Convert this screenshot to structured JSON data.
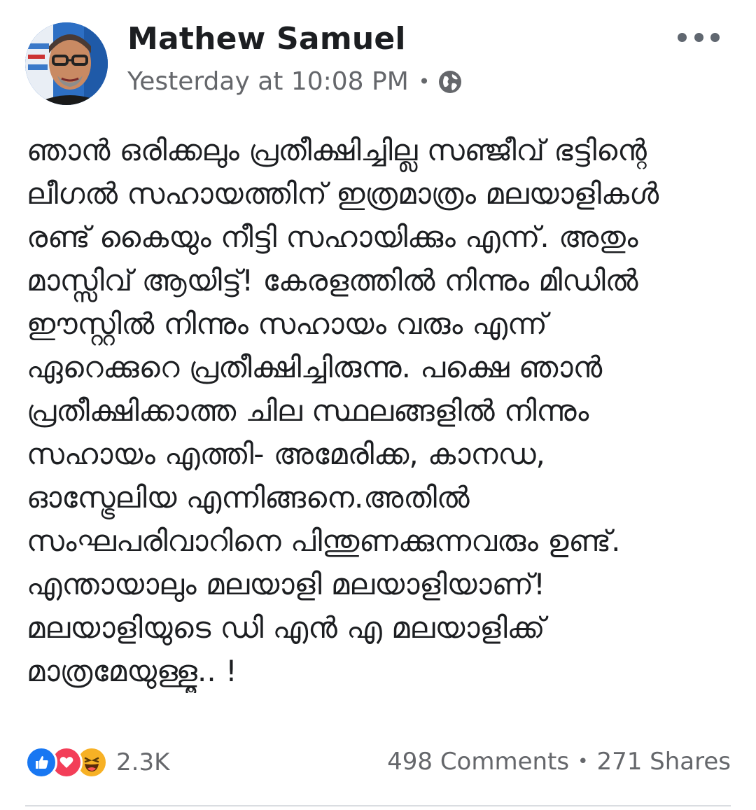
{
  "post": {
    "author": "Mathew Samuel",
    "timestamp": "Yesterday at 10:08 PM",
    "separator": "•",
    "privacy_icon": "globe-icon",
    "more_icon": "more-options-icon",
    "text_lines": [
      "ഞാൻ ഒരിക്കലും പ്രതീക്ഷിച്ചില്ല സഞ്ജീവ് ഭട്ടിന്റെ",
      "ലീഗൽ സഹായത്തിന് ഇത്രമാത്രം മലയാളികൾ",
      "രണ്ട് കൈയും നീട്ടി സഹായിക്കും എന്ന്. അതും",
      "മാസ്സിവ് ആയിട്ട്! കേരളത്തിൽ നിന്നും മിഡിൽ",
      "ഈസ്റ്റിൽ  നിന്നും സഹായം വരും എന്ന്",
      "ഏറെക്കുറെ പ്രതീക്ഷിച്ചിരുന്നു. പക്ഷെ ഞാൻ",
      "പ്രതീക്ഷിക്കാത്ത ചില സ്ഥലങ്ങളിൽ നിന്നും",
      "സഹായം എത്തി- അമേരിക്ക, കാനഡ,",
      "ഓസ്ട്രേലിയ എന്നിങ്ങനെ.അതിൽ",
      "സംഘപരിവാറിനെ പിന്തുണക്കുന്നവരും ഉണ്ട്.",
      "എന്തായാലും മലയാളി മലയാളിയാണ്!",
      "മലയാളിയുടെ ഡി എൻ എ മലയാളിക്ക്",
      "മാത്രമേയുള്ളൂ.. !"
    ]
  },
  "footer": {
    "reaction_icons": [
      "like-icon",
      "love-icon",
      "haha-icon"
    ],
    "reaction_count": "2.3K",
    "comments": "498 Comments",
    "separator": "•",
    "shares": "271 Shares"
  },
  "colors": {
    "text": "#1c1e21",
    "secondary": "#65676b",
    "like": "#1877f2",
    "love": "#f33e58",
    "haha": "#f7b125",
    "divider": "#dadde1"
  }
}
